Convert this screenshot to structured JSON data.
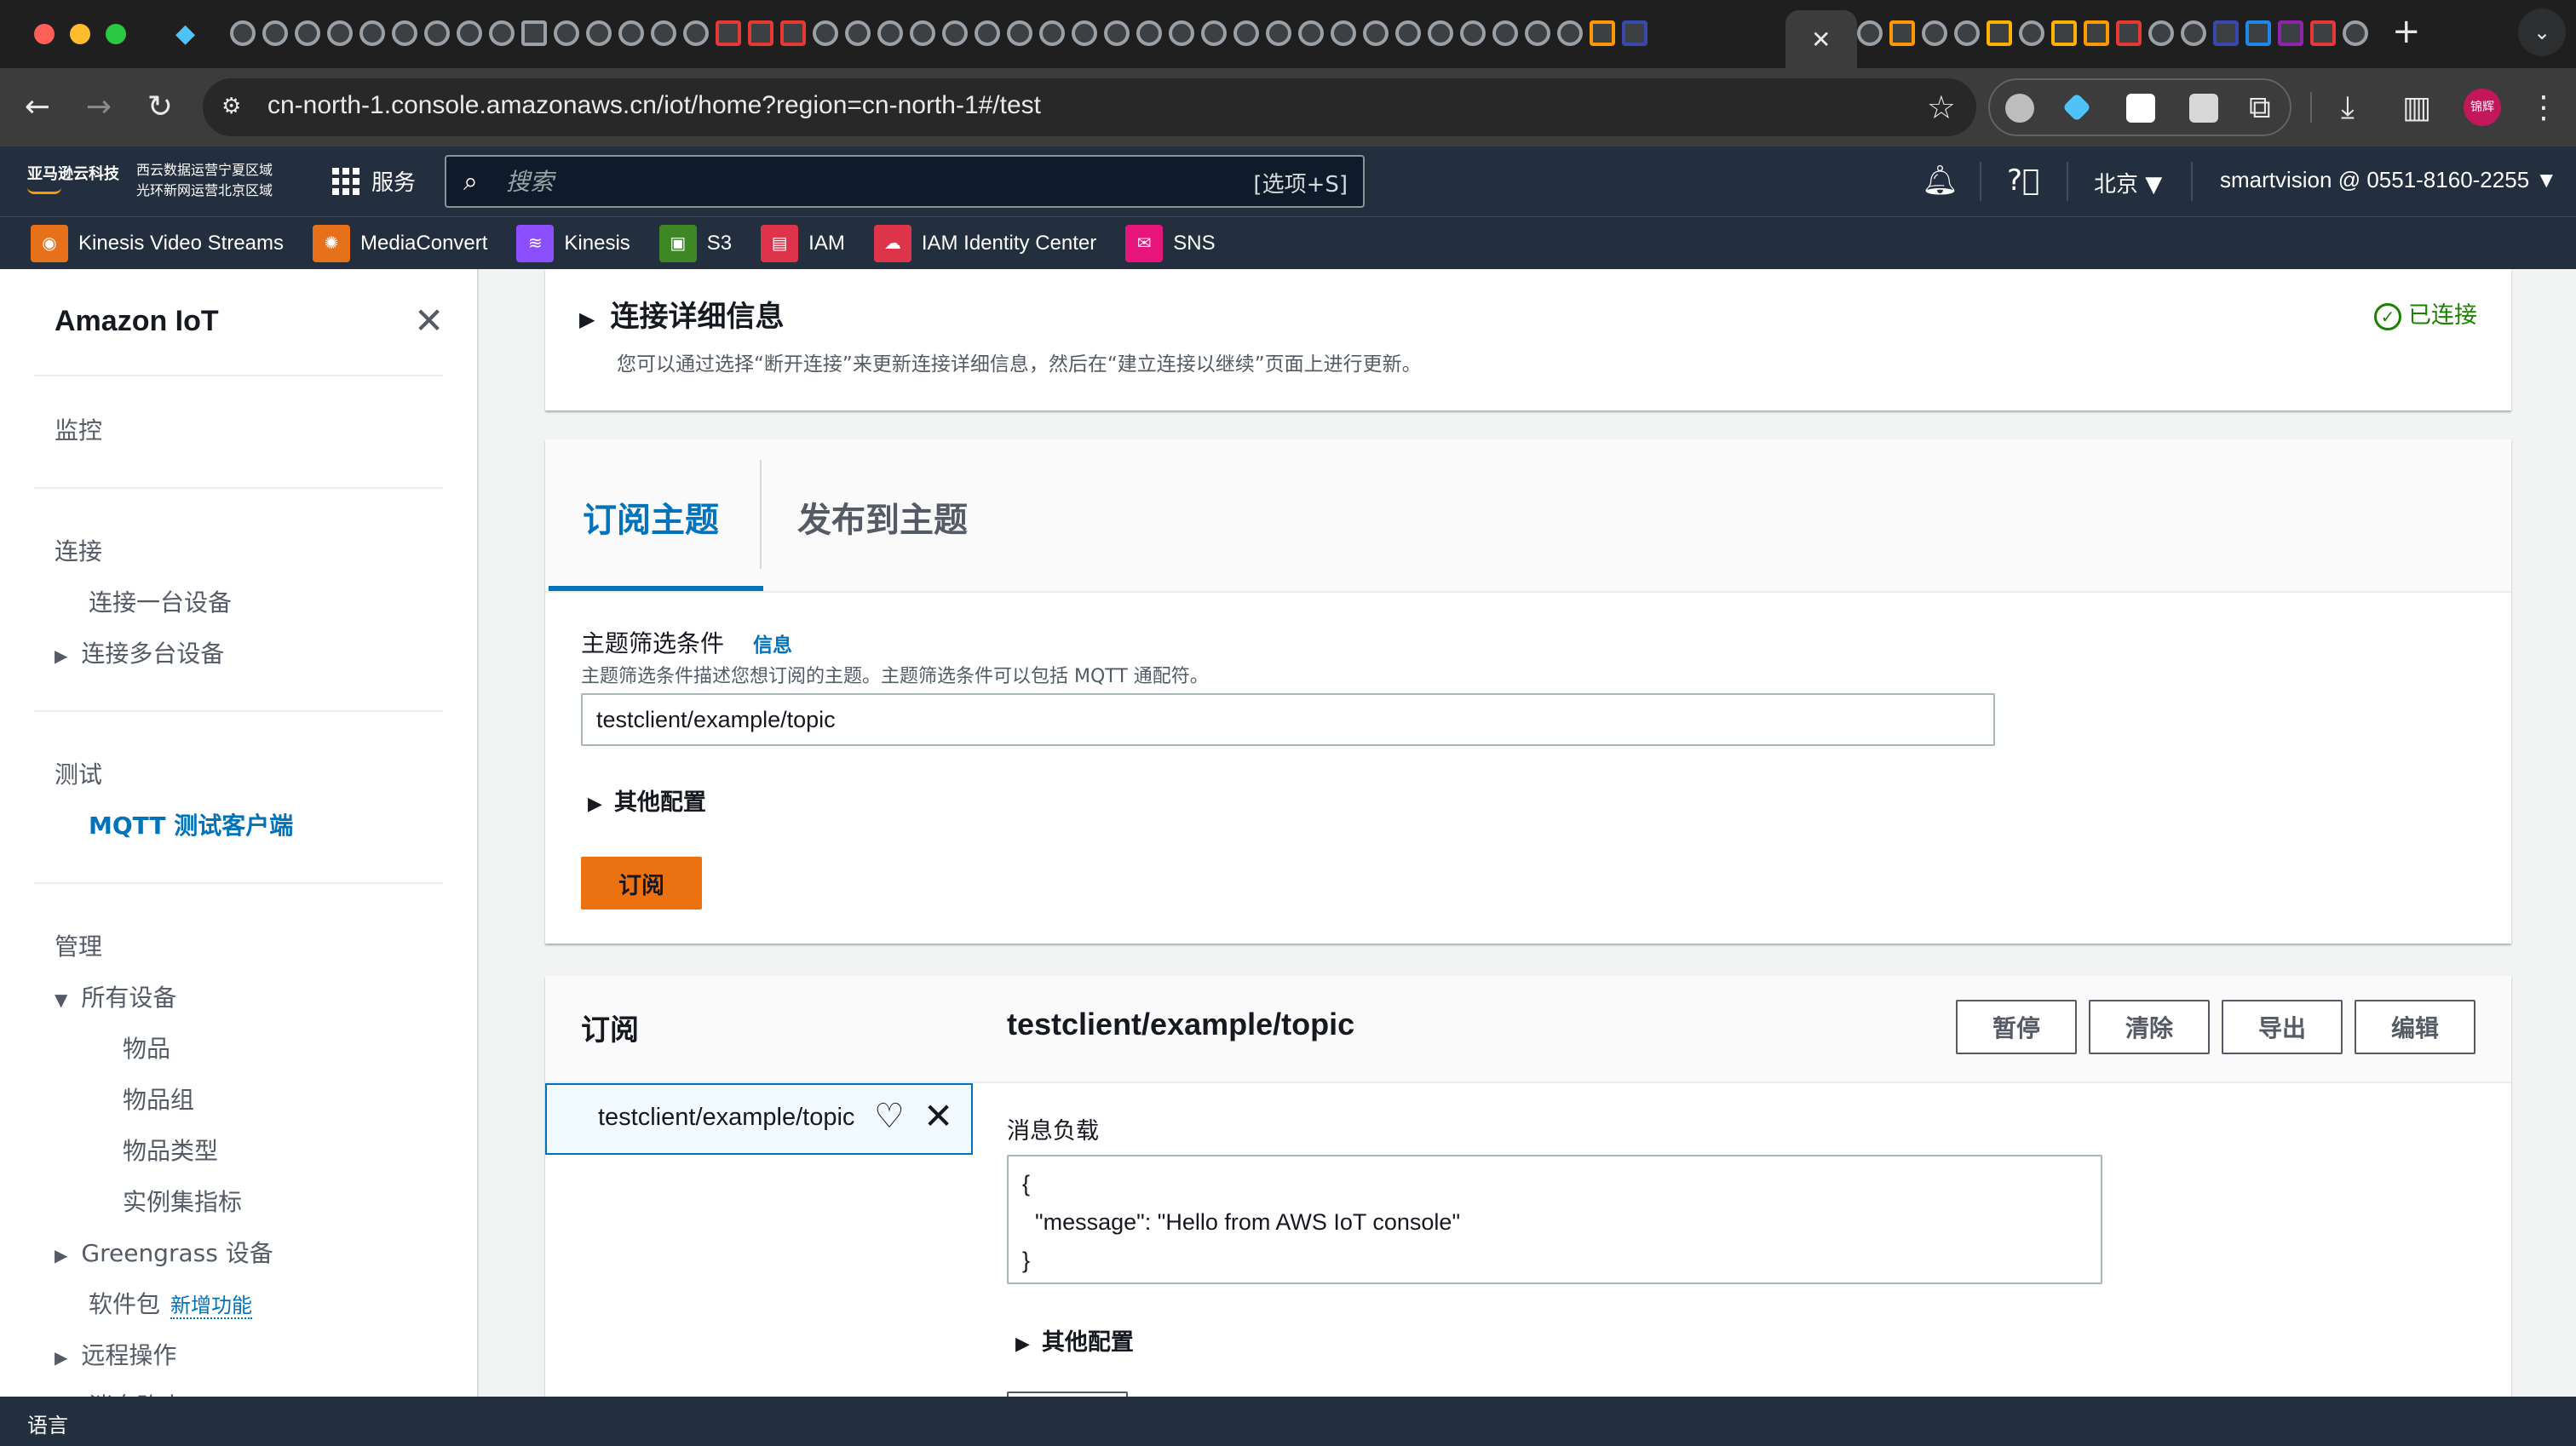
{
  "browser": {
    "url": "cn-north-1.console.amazonaws.cn/iot/home?region=cn-north-1#/test",
    "profile_initials": "锦辉"
  },
  "aws_nav": {
    "logo_text": "亚马逊云科技",
    "region_line1": "西云数据运营宁夏区域",
    "region_line2": "光环新网运营北京区域",
    "services_label": "服务",
    "search_placeholder": "搜索",
    "search_shortcut": "[选项+S]",
    "region": "北京",
    "account": "smartvision @ 0551-8160-2255"
  },
  "favorites": [
    {
      "label": "Kinesis Video Streams",
      "color": "#e7711b",
      "icon": "kinesis-video-icon"
    },
    {
      "label": "MediaConvert",
      "color": "#e7711b",
      "icon": "mediaconvert-icon"
    },
    {
      "label": "Kinesis",
      "color": "#8c4fff",
      "icon": "kinesis-icon"
    },
    {
      "label": "S3",
      "color": "#3f8624",
      "icon": "s3-icon"
    },
    {
      "label": "IAM",
      "color": "#dd344c",
      "icon": "iam-icon"
    },
    {
      "label": "IAM Identity Center",
      "color": "#dd344c",
      "icon": "identity-center-icon"
    },
    {
      "label": "SNS",
      "color": "#e7157b",
      "icon": "sns-icon"
    }
  ],
  "sidebar": {
    "title": "Amazon IoT",
    "monitor": "监控",
    "connect": "连接",
    "connect_one": "连接一台设备",
    "connect_many": "连接多台设备",
    "test": "测试",
    "mqtt_client": "MQTT 测试客户端",
    "manage": "管理",
    "all_devices": "所有设备",
    "things": "物品",
    "thing_groups": "物品组",
    "thing_types": "物品类型",
    "fleet_metrics": "实例集指标",
    "greengrass": "Greengrass 设备",
    "software_packages": "软件包",
    "new_badge": "新增功能",
    "remote_ops": "远程操作",
    "cut_off": "消息路由"
  },
  "connection": {
    "title": "连接详细信息",
    "description": "您可以通过选择“断开连接”来更新连接详细信息，然后在“建立连接以继续”页面上进行更新。",
    "status": "已连接"
  },
  "subscribe_panel": {
    "tab_subscribe": "订阅主题",
    "tab_publish": "发布到主题",
    "filter_label": "主题筛选条件",
    "info_link": "信息",
    "filter_description": "主题筛选条件描述您想订阅的主题。主题筛选条件可以包括 MQTT 通配符。",
    "filter_value": "testclient/example/topic",
    "additional_config": "其他配置",
    "subscribe_button": "订阅"
  },
  "subscriptions": {
    "heading": "订阅",
    "current_topic": "testclient/example/topic",
    "pause": "暂停",
    "clear": "清除",
    "export": "导出",
    "edit": "编辑",
    "list_item": "testclient/example/topic",
    "payload_label": "消息负载",
    "payload": "{\n  \"message\": \"Hello from AWS IoT console\"\n}",
    "additional_config": "其他配置"
  },
  "footer": {
    "language": "语言"
  }
}
